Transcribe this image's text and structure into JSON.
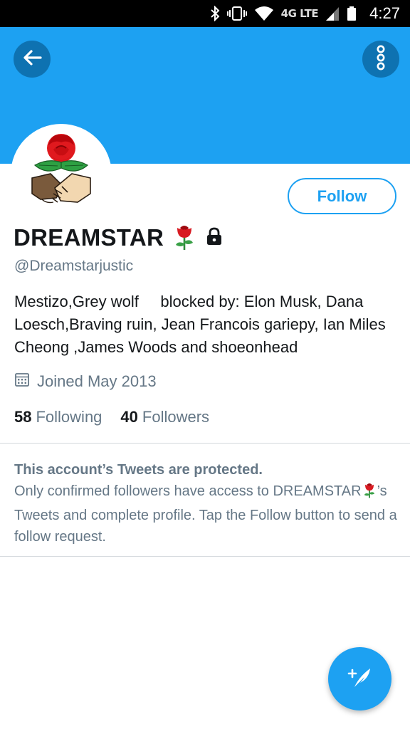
{
  "status_bar": {
    "network": "4G LTE",
    "time": "4:27",
    "icons": [
      "bluetooth-icon",
      "vibrate-icon",
      "wifi-icon",
      "signal-icon",
      "battery-icon"
    ]
  },
  "header": {
    "back_icon": "arrow-left-icon",
    "more_icon": "more-vertical-icon",
    "banner_color": "#1da1f2"
  },
  "profile": {
    "avatar_icon": "rose-handshake-logo",
    "follow_label": "Follow",
    "display_name": "DREAMSTAR",
    "name_emoji_icon": "rose-icon",
    "protected_icon": "lock-icon",
    "handle": "@Dreamstarjustic",
    "bio": "Mestizo,Grey wolf     blocked by: Elon Musk, Dana Loesch,Braving ruin, Jean Francois gariepy, Ian Miles Cheong ,James Woods and shoeonhead",
    "joined": "Joined May 2013",
    "following_count": "58",
    "following_label": "Following",
    "followers_count": "40",
    "followers_label": "Followers"
  },
  "protected_notice": {
    "title": "This account’s Tweets are protected.",
    "body_part1": "Only confirmed followers have access to DREAMSTAR",
    "body_part2": "’s Tweets and complete profile. Tap the Follow button to send a follow request."
  },
  "fab": {
    "icon": "compose-tweet-icon"
  },
  "colors": {
    "accent": "#1da1f2",
    "dark_accent": "#0e72b1",
    "secondary_text": "#657786",
    "primary_text": "#14171a"
  }
}
